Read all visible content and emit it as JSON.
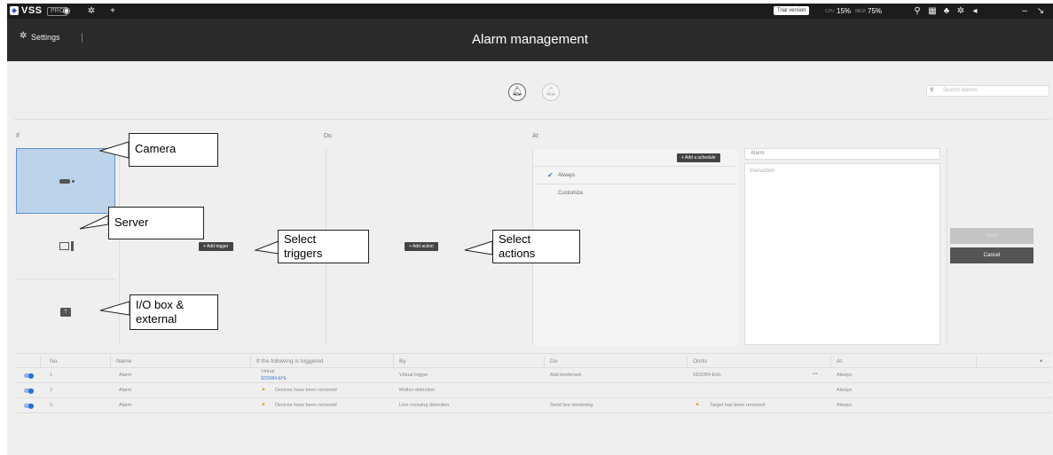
{
  "topbar": {
    "logo": "VSS",
    "edition": "PRO",
    "trial_label": "Trial version",
    "cpu_label": "CPU",
    "cpu_value": "15%",
    "mem_label": "MEM",
    "mem_value": "75%",
    "icons": [
      "eye-icon",
      "gear-icon",
      "plus-icon",
      "search-icon",
      "grid-icon",
      "bell-icon",
      "gear-icon",
      "volume-icon",
      "minimize-icon",
      "collapse-icon"
    ]
  },
  "titlebar": {
    "settings_label": "Settings",
    "title": "Alarm management"
  },
  "toolbar": {
    "search_placeholder": "Search alarms"
  },
  "columns": {
    "if": "If",
    "do": "Do",
    "at": "At"
  },
  "triggers": {
    "add_trigger": "Add trigger"
  },
  "actions": {
    "add_action": "Add action"
  },
  "schedule": {
    "add_schedule": "Add a schedule",
    "items": [
      "Always",
      "Customize"
    ],
    "selected": "Always"
  },
  "form": {
    "alarm_value": "Alarm",
    "instruction_placeholder": "Instruction",
    "apply": "Apply",
    "cancel": "Cancel"
  },
  "callouts": {
    "camera": "Camera",
    "server": "Server",
    "io": "I/O box & external",
    "triggers": "Select triggers",
    "actions": "Select actions"
  },
  "table": {
    "headers": [
      "No.",
      "Name",
      "If the following is triggered",
      "By",
      "Do",
      "On/to",
      "At"
    ],
    "rows": [
      {
        "no": "1",
        "name": "Alarm",
        "trigger": "Virtual",
        "trigger_sub": "SD9384-EHL",
        "by": "Virtual trigger",
        "do": "Add bookmark",
        "on_to": "SD9384-EHL",
        "more": "•••",
        "at": "Always"
      },
      {
        "no": "2",
        "name": "Alarm",
        "trigger": "Devices have been removed",
        "by": "Motion detection",
        "do": "",
        "on_to": "",
        "at": "Always"
      },
      {
        "no": "3",
        "name": "Alarm",
        "trigger": "Devices have been removed",
        "by": "Line crossing detection",
        "do": "Send live streaming",
        "on_to": "Target has been removed",
        "at": "Always"
      }
    ]
  },
  "colors": {
    "accent": "#3a7bd5",
    "warning": "#e2a21c",
    "titlebar": "#2a2a2a"
  }
}
